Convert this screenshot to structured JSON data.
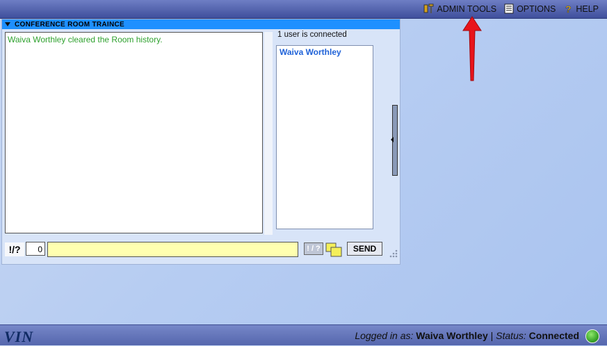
{
  "topnav": {
    "admin_tools": "ADMIN TOOLS",
    "options": "OPTIONS",
    "help": "HELP"
  },
  "panel": {
    "title": "CONFERENCE ROOM TRAINCE"
  },
  "chat": {
    "messages": [
      "Waiva Worthley cleared the Room history."
    ]
  },
  "users": {
    "count_text": "1 user is connected",
    "list": [
      "Waiva Worthley"
    ]
  },
  "input": {
    "macro_label": "!/?",
    "char_count": "0",
    "message_value": "",
    "small_button_label": "! / ?",
    "send_label": "SEND"
  },
  "statusbar": {
    "logo": "VIN",
    "logged_in_label": "Logged in as:",
    "user": "Waiva Worthley",
    "separator": "|",
    "status_label": "Status:",
    "status_value": "Connected"
  },
  "colors": {
    "status_indicator": "#3aa52a",
    "arrow": "#e8141b"
  }
}
